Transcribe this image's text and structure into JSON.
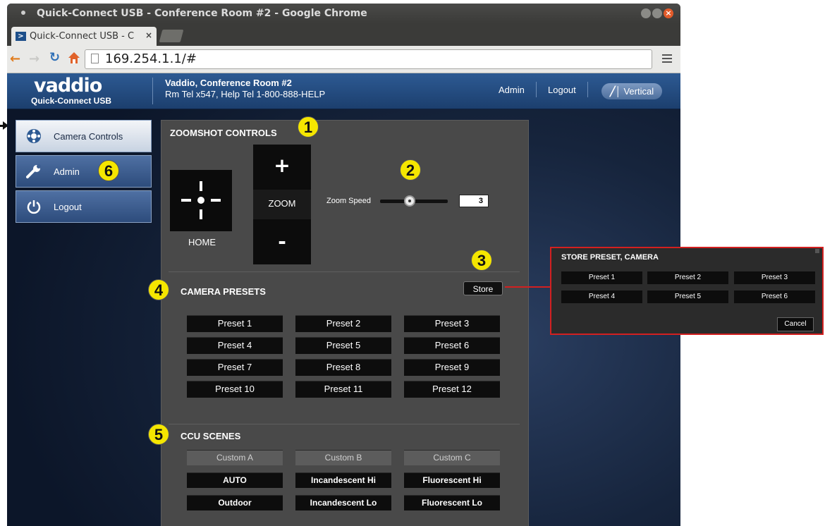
{
  "browser": {
    "window_title": "Quick-Connect USB - Conference Room #2 - Google Chrome",
    "tab_title": "Quick-Connect USB - C",
    "tab_close": "×",
    "url": "169.254.1.1/#",
    "close_glyph": "×"
  },
  "header": {
    "logo": "vaddio",
    "logo_sub": "Quick-Connect USB",
    "room_name": "Vaddio, Conference Room #2",
    "room_phone": "Rm Tel x547, Help Tel 1-800-888-HELP",
    "admin_link": "Admin",
    "logout_link": "Logout",
    "vertical_button": "Vertical"
  },
  "sidebar": {
    "items": [
      {
        "label": "Camera Controls",
        "icon": "camera-controls-icon",
        "active": true
      },
      {
        "label": "Admin",
        "icon": "wrench-icon",
        "active": false
      },
      {
        "label": "Logout",
        "icon": "power-icon",
        "active": false
      }
    ]
  },
  "zoomshot": {
    "title": "ZOOMSHOT CONTROLS",
    "home_label": "HOME",
    "zoom_in": "+",
    "zoom_label": "ZOOM",
    "zoom_out": "-",
    "speed_label": "Zoom Speed",
    "speed_value": "3"
  },
  "presets": {
    "title": "CAMERA PRESETS",
    "store_label": "Store",
    "buttons": [
      "Preset 1",
      "Preset 2",
      "Preset 3",
      "Preset 4",
      "Preset 5",
      "Preset 6",
      "Preset 7",
      "Preset 8",
      "Preset 9",
      "Preset 10",
      "Preset 11",
      "Preset 12"
    ]
  },
  "ccu": {
    "title": "CCU SCENES",
    "custom": [
      "Custom A",
      "Custom B",
      "Custom C"
    ],
    "scenes": [
      "AUTO",
      "Incandescent Hi",
      "Fluorescent Hi",
      "Outdoor",
      "Incandescent Lo",
      "Fluorescent Lo"
    ]
  },
  "popup": {
    "title": "STORE PRESET, CAMERA",
    "buttons": [
      "Preset 1",
      "Preset 2",
      "Preset 3",
      "Preset 4",
      "Preset 5",
      "Preset 6"
    ],
    "cancel": "Cancel"
  },
  "callouts": [
    "1",
    "2",
    "3",
    "4",
    "5",
    "6"
  ],
  "colors": {
    "badge": "#f5e600",
    "popup_border": "#d32020",
    "header": "#2d5a93"
  }
}
